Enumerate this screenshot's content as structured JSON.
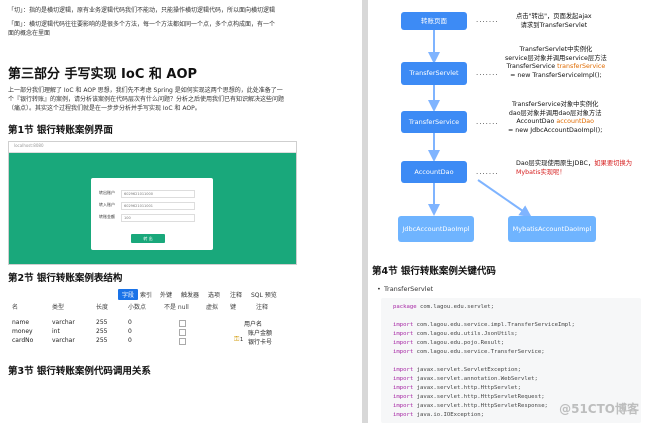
{
  "left_page": {
    "intro_lines": [
      "「切」：指的是横切逻辑，原有业务逻辑代码我们不能动，只能操作横切逻辑代码，所以面向横切逻辑",
      "「面」：横切逻辑代码往往要影响的是很多个方法，每一个方法都如同一个点，多个点构成面，有一个",
      "面的概念在里面"
    ],
    "part3_title": "第三部分 手写实现 IoC 和 AOP",
    "part3_body": [
      "上一部分我们理解了 IoC 和 AOP 思想，我们先不考虑 Spring 是如何实现这两个思想的，此处准备了一",
      "个『银行转账』的案例，请分析该案例在代码层次有什么问题？分析之后使用我们已有知识解决这些问题",
      "（痛点）。其实这个过程我们就是在一步步分析并手写实现 IoC 和 AOP。"
    ],
    "section1_title": "第1节 银行转账案例界面",
    "screenshot": {
      "tab_title": "localhost:8080",
      "rows": [
        {
          "label": "转出账户",
          "value": "6029621011000"
        },
        {
          "label": "转入账户",
          "value": "6029621011001"
        },
        {
          "label": "转账金额",
          "value": "100"
        }
      ],
      "button": "转 出"
    },
    "section2_title": "第2节 银行转账案例表结构",
    "table_tabs": [
      "字段",
      "索引",
      "外键",
      "触发器",
      "选项",
      "注释",
      "SQL 预览"
    ],
    "table_headers": [
      "名",
      "类型",
      "长度",
      "小数点",
      "不是 null",
      "虚拟",
      "键",
      "注释"
    ],
    "table_rows": [
      {
        "name": "name",
        "type": "varchar",
        "length": "255",
        "decimals": "0",
        "comment": "用户名",
        "key": ""
      },
      {
        "name": "money",
        "type": "int",
        "length": "255",
        "decimals": "0",
        "comment": "账户金额",
        "key": ""
      },
      {
        "name": "cardNo",
        "type": "varchar",
        "length": "255",
        "decimals": "0",
        "comment": "银行卡号",
        "key": "1"
      }
    ],
    "section3_title": "第3节 银行转账案例代码调用关系"
  },
  "right_page": {
    "diagram": {
      "nodes": {
        "page": "转账页面",
        "servlet": "TransferServlet",
        "service": "TransferService",
        "dao": "AccountDao",
        "jdbc": "JdbcAccountDaoImpl",
        "mybatis": "MybatisAccountDaoImpl"
      },
      "ann1": [
        "点击\"转出\"，页面发起ajax",
        "请求到TransferServlet"
      ],
      "ann2": [
        "TransferServlet中实例化",
        "service层对象并调用service层方法",
        "TransferService ",
        "transferService",
        "= new TransferServiceImpl();"
      ],
      "ann3": [
        "TransferService对象中实例化",
        "dao层对象并调用dao层对象方法",
        "AccountDao ",
        "accountDao",
        "= new JdbcAccountDaoImpl();"
      ],
      "ann4": [
        "Dao层实现使用原生JDBC，",
        "如果要切换为",
        "Mybatis实现呢！"
      ]
    },
    "section4_title": "第4节 银行转账案例关键代码",
    "bullet": "TransferServlet",
    "code_lines": [
      {
        "kw": "package",
        "rest": " com.lagou.edu.servlet;"
      },
      {
        "kw": "",
        "rest": ""
      },
      {
        "kw": "import",
        "rest": " com.lagou.edu.service.impl.TransferServiceImpl;"
      },
      {
        "kw": "import",
        "rest": " com.lagou.edu.utils.JsonUtils;"
      },
      {
        "kw": "import",
        "rest": " com.lagou.edu.pojo.Result;"
      },
      {
        "kw": "import",
        "rest": " com.lagou.edu.service.TransferService;"
      },
      {
        "kw": "",
        "rest": ""
      },
      {
        "kw": "import",
        "rest": " javax.servlet.ServletException;"
      },
      {
        "kw": "import",
        "rest": " javax.servlet.annotation.WebServlet;"
      },
      {
        "kw": "import",
        "rest": " javax.servlet.http.HttpServlet;"
      },
      {
        "kw": "import",
        "rest": " javax.servlet.http.HttpServletRequest;"
      },
      {
        "kw": "import",
        "rest": " javax.servlet.http.HttpServletResponse;"
      },
      {
        "kw": "import",
        "rest": " java.io.IOException;"
      }
    ],
    "watermark": "@51CTO博客"
  }
}
